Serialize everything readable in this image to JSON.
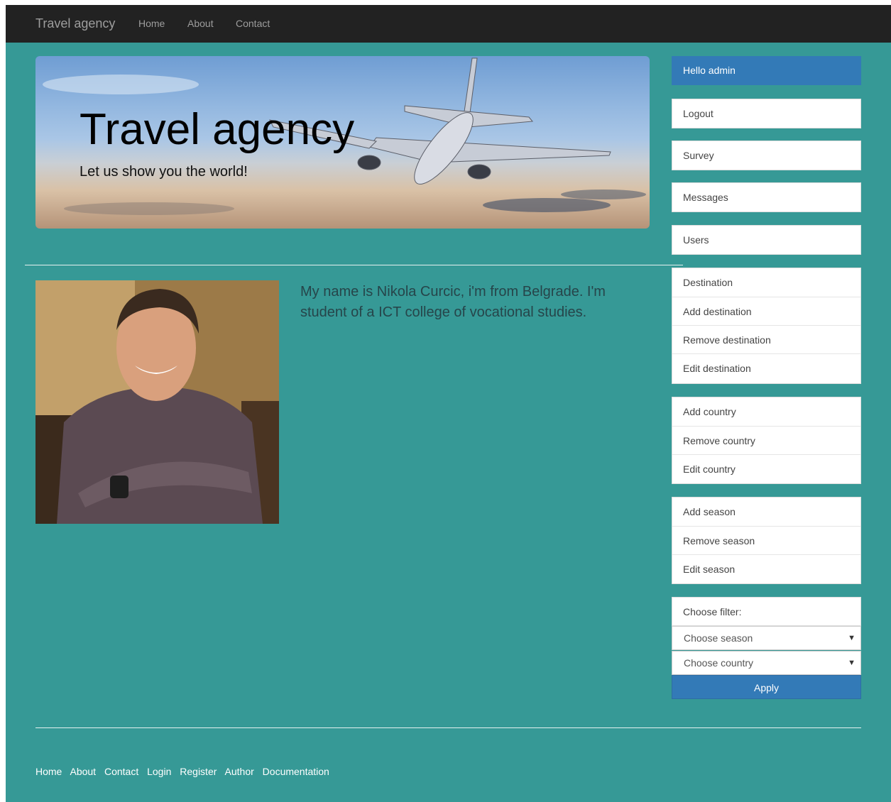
{
  "navbar": {
    "brand": "Travel agency",
    "links": [
      "Home",
      "About",
      "Contact"
    ]
  },
  "jumbotron": {
    "title": "Travel agency",
    "subtitle": "Let us show you the world!"
  },
  "about": {
    "bio": "My name is Nikola Curcic, i'm from Belgrade. I'm student of a ICT college of vocational studies."
  },
  "sidebar": {
    "greeting": "Hello admin",
    "logout": "Logout",
    "survey": "Survey",
    "messages": "Messages",
    "users": "Users",
    "destination_group": [
      "Destination",
      "Add destination",
      "Remove destination",
      "Edit destination"
    ],
    "country_group": [
      "Add country",
      "Remove country",
      "Edit country"
    ],
    "season_group": [
      "Add season",
      "Remove season",
      "Edit season"
    ],
    "filter": {
      "label": "Choose filter:",
      "season_select": "Choose season",
      "country_select": "Choose country",
      "apply": "Apply"
    }
  },
  "footer": {
    "links": [
      "Home",
      "About",
      "Contact",
      "Login",
      "Register",
      "Author",
      "Documentation"
    ]
  },
  "colors": {
    "background": "#369996",
    "navbar": "#222222",
    "primary": "#337ab7"
  }
}
